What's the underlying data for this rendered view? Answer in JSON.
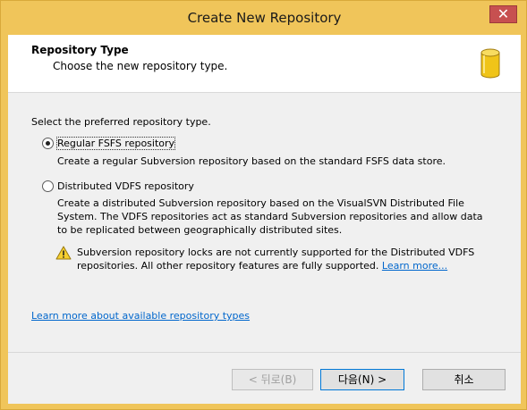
{
  "window": {
    "title": "Create New Repository",
    "close_glyph": "✕"
  },
  "header": {
    "title": "Repository Type",
    "subtitle": "Choose the new repository type.",
    "icon": "database-icon"
  },
  "body": {
    "prompt": "Select the preferred repository type.",
    "options": [
      {
        "label": "Regular FSFS repository",
        "selected": true,
        "description": [
          "Create a regular Subversion repository based on the standard FSFS data store."
        ]
      },
      {
        "label": "Distributed VDFS repository",
        "selected": false,
        "description": [
          "Create a distributed Subversion repository based on the VisualSVN Distributed File",
          "System. The VDFS repositories act as standard Subversion repositories and allow data",
          "to be replicated between geographically distributed sites."
        ]
      }
    ],
    "warning": {
      "icon": "warning-icon",
      "lines": [
        "Subversion repository locks are not currently supported for the Distributed VDFS",
        "repositories. All other repository features are fully supported."
      ],
      "link": "Learn more..."
    },
    "footer_link": "Learn more about available repository types"
  },
  "buttons": {
    "back": "< 뒤로(B)",
    "next": "다음(N) >",
    "cancel": "취소"
  },
  "colors": {
    "title_bar": "#f0c55a",
    "close_button": "#c75050",
    "link": "#0066cc",
    "default_button_border": "#0078d7"
  }
}
